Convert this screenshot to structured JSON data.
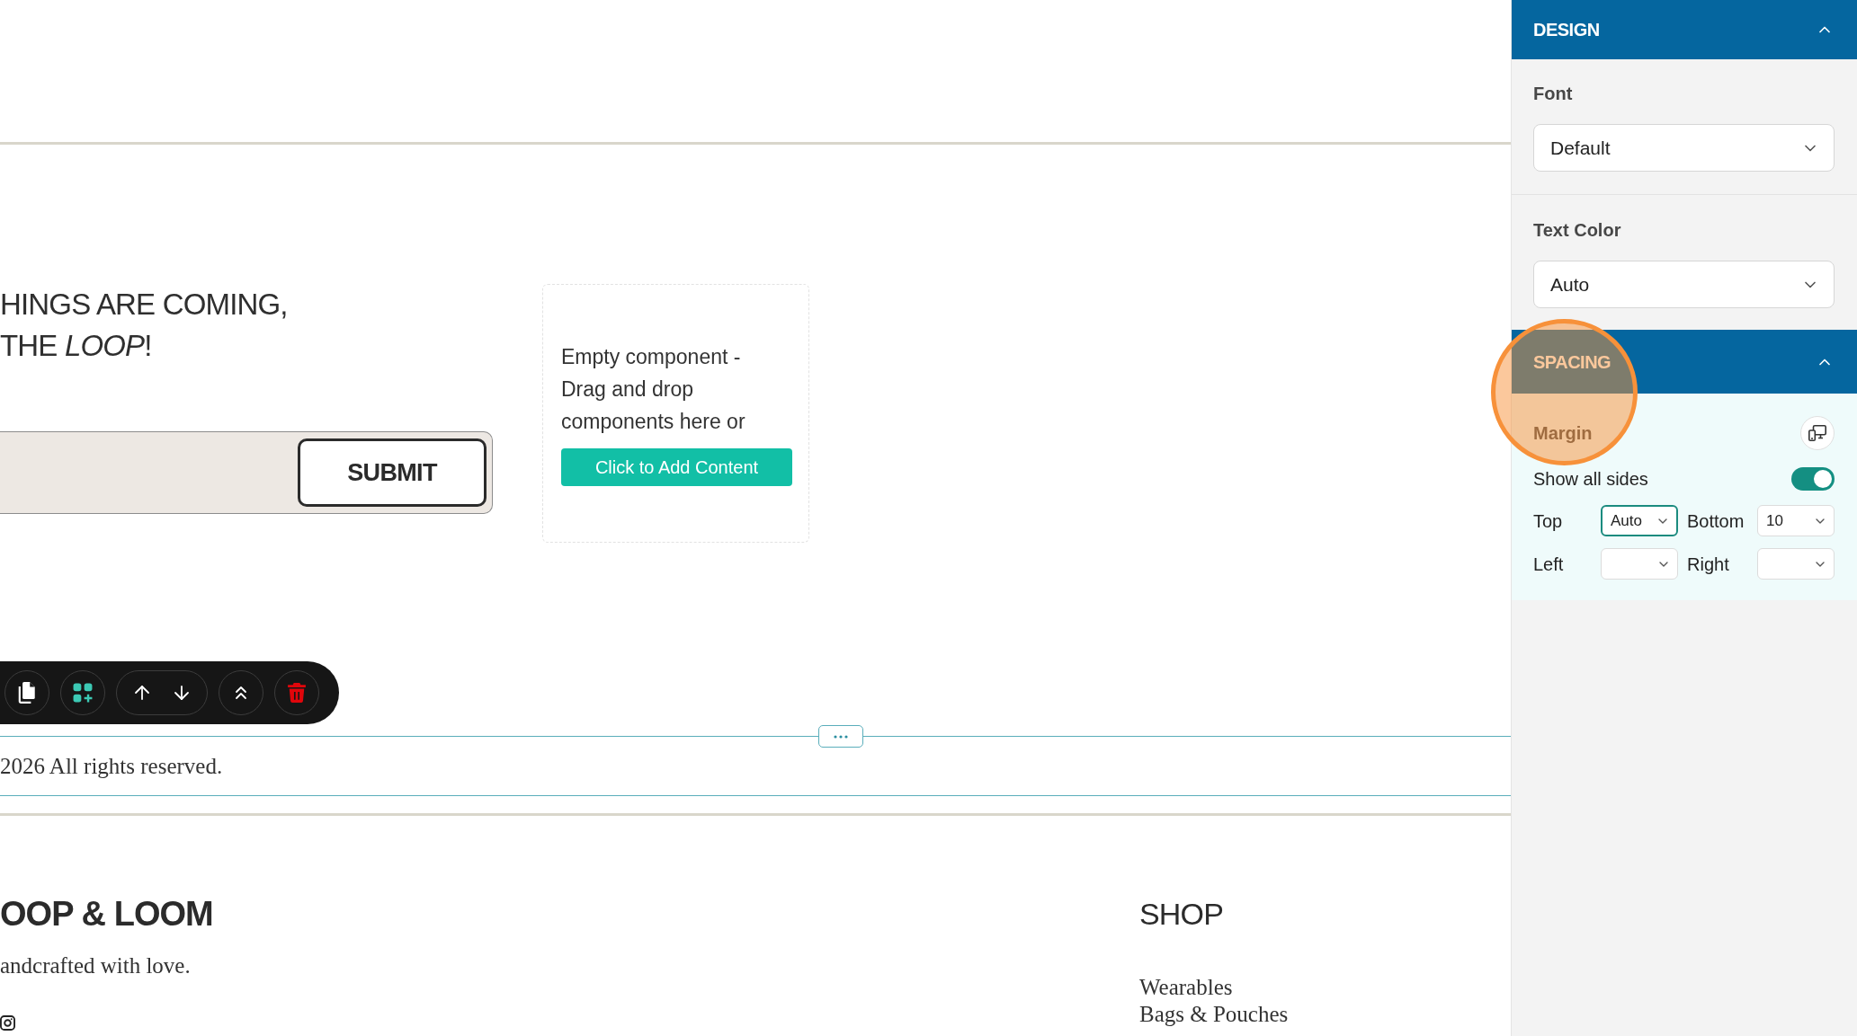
{
  "canvas": {
    "hero": {
      "heading_lines": [
        "HINGS ARE COMING,",
        "THE *LOOP*!"
      ],
      "form": {
        "button": "SUBMIT"
      },
      "empty_component": {
        "message": "Empty component - Drag and drop components here or",
        "button": "Click to Add Content"
      }
    },
    "copyright": "2026 All rights reserved.",
    "footer": {
      "brand": "OOP & LOOM",
      "tagline": "andcrafted with love.",
      "columns": [
        {
          "heading": "SHOP",
          "links": [
            "Wearables",
            "Bags & Pouches"
          ]
        }
      ]
    }
  },
  "panel": {
    "design": {
      "title": "DESIGN",
      "expanded": true,
      "highlighted": false,
      "fields": [
        {
          "label": "Font",
          "value": "Default"
        },
        {
          "label": "Text Color",
          "value": "Auto"
        }
      ]
    },
    "spacing": {
      "title": "SPACING",
      "expanded": true,
      "highlighted": true,
      "group": "Margin",
      "show_all_sides": {
        "label": "Show all sides",
        "on": true
      },
      "sides": [
        {
          "label": "Top",
          "value": "Auto",
          "focused": true
        },
        {
          "label": "Bottom",
          "value": "10",
          "focused": false
        },
        {
          "label": "Left",
          "focused": false
        },
        {
          "label": "Right",
          "focused": false
        }
      ]
    }
  }
}
